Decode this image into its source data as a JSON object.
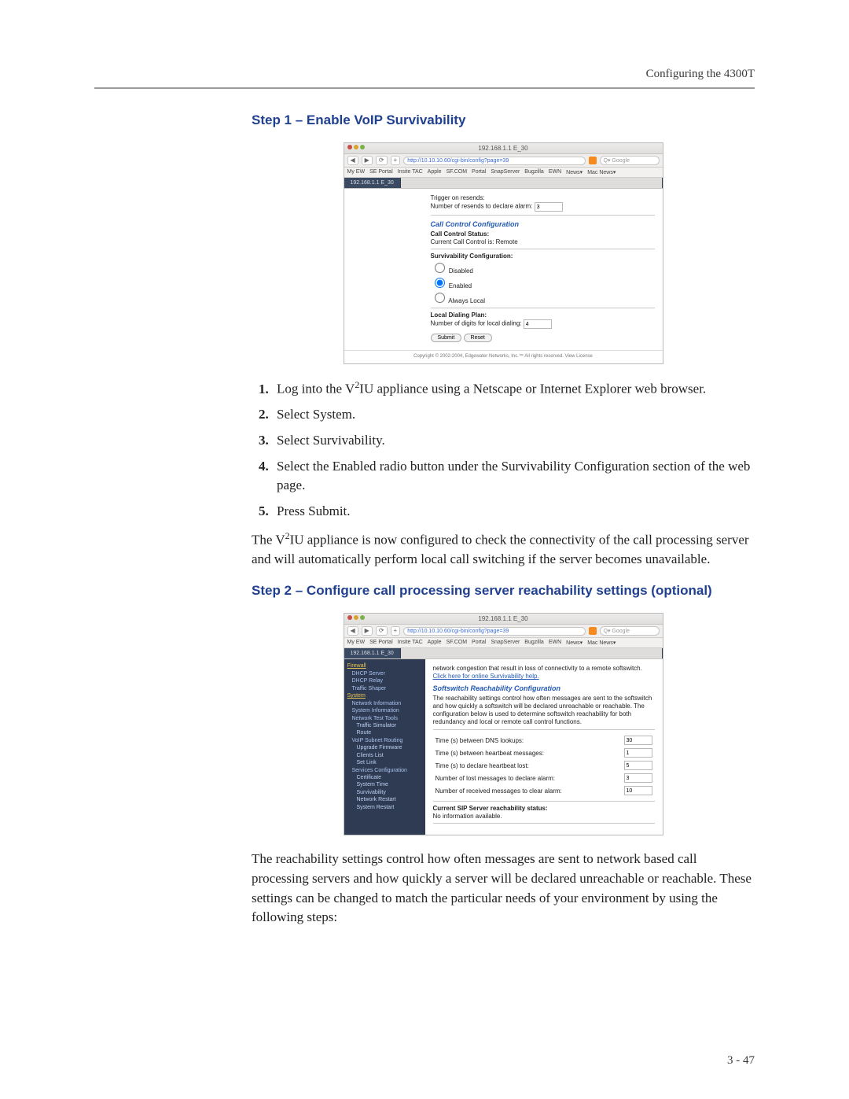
{
  "header": {
    "running": "Configuring the 4300T"
  },
  "step1": {
    "heading": "Step 1 – Enable VoIP Survivability",
    "shot": {
      "title_ip": "192.168.1.1 E_30",
      "url": "http://10.10.10.60/cgi-bin/config?page=39",
      "search_placeholder": "Q▾ Google",
      "bookmarks": [
        "My EW",
        "SE Portal",
        "Insite TAC",
        "Apple",
        "SF.COM",
        "Portal",
        "SnapServer",
        "Bugzilla",
        "EWN",
        "News▾",
        "Mac News▾"
      ],
      "tab_active": "192.168.1.1 E_30",
      "trigger_label": "Trigger on resends:",
      "resends_label": "Number of resends to declare alarm:",
      "resends_value": "3",
      "cc_title": "Call Control Configuration",
      "cc_status_label": "Call Control Status:",
      "cc_status_value": "Current Call Control is: Remote",
      "surv_title": "Survivability Configuration:",
      "opt_disabled": "Disabled",
      "opt_enabled": "Enabled",
      "opt_always": "Always Local",
      "ldp_title": "Local Dialing Plan:",
      "ldp_label": "Number of digits for local dialing:",
      "ldp_value": "4",
      "btn_submit": "Submit",
      "btn_reset": "Reset",
      "footer": "Copyright © 2002-2004, Edgewater Networks, Inc.™  All rights reserved. View License"
    },
    "items": [
      "Log into the V²IU appliance using a Netscape or Internet Explorer web browser.",
      "Select System.",
      "Select Survivability.",
      "Select the Enabled radio button under the Survivability Configuration section of the web page.",
      "Press Submit."
    ],
    "para": "The V²IU appliance is now configured to check the connectivity of the call processing server and will automatically perform local call switching if the server becomes unavailable."
  },
  "step2": {
    "heading": "Step 2 – Configure call processing server reachability settings (optional)",
    "shot": {
      "title_ip": "192.168.1.1 E_30",
      "url": "http://10.10.10.60/cgi-bin/config?page=39",
      "search_placeholder": "Q▾ Google",
      "bookmarks": [
        "My EW",
        "SE Portal",
        "Insite TAC",
        "Apple",
        "SF.COM",
        "Portal",
        "SnapServer",
        "Bugzilla",
        "EWN",
        "News▾",
        "Mac News▾"
      ],
      "tab_active": "192.168.1.1 E_30",
      "sidebar": {
        "firewall": "Firewall",
        "dhcp_server": "DHCP Server",
        "dhcp_relay": "DHCP Relay",
        "traffic_shaper": "Traffic Shaper",
        "system": "System",
        "net_info": "Network Information",
        "sys_info": "System Information",
        "net_test": "Network Test Tools",
        "traffic_sim": "Traffic Simulator",
        "route": "Route",
        "voip_subnet": "VoIP Subnet Routing",
        "upgrade": "Upgrade Firmware",
        "clients": "Clients List",
        "set_link": "Set Link",
        "services": "Services Configuration",
        "certificate": "Certificate",
        "sys_time": "System Time",
        "survivability": "Survivability",
        "net_restart": "Network Restart",
        "sys_restart": "System Restart"
      },
      "intro": "network congestion that result in loss of connectivity to a remote softswitch.",
      "help_link": "Click here for online Survivability help.",
      "reach_title": "Softswitch Reachability Configuration",
      "reach_desc": "The reachability settings control how often messages are sent to the softswitch and how quickly a softswitch will be declared unreachable or reachable. The configuration below is used to determine softswitch reachability for both redundancy and local or remote call control functions.",
      "rows": [
        {
          "label": "Time (s) between DNS lookups:",
          "value": "30"
        },
        {
          "label": "Time (s) between heartbeat messages:",
          "value": "1"
        },
        {
          "label": "Time (s) to declare heartbeat lost:",
          "value": "5"
        },
        {
          "label": "Number of lost messages to declare alarm:",
          "value": "3"
        },
        {
          "label": "Number of received messages to clear alarm:",
          "value": "10"
        }
      ],
      "status_title": "Current SIP Server reachability status:",
      "status_value": "No information available."
    },
    "para": "The reachability settings control how often messages are sent to network based call processing servers and how quickly a server will be declared unreachable or reachable. These settings can be changed to match the particular needs of your environment by using the following steps:"
  },
  "pagenum": "3 - 47"
}
